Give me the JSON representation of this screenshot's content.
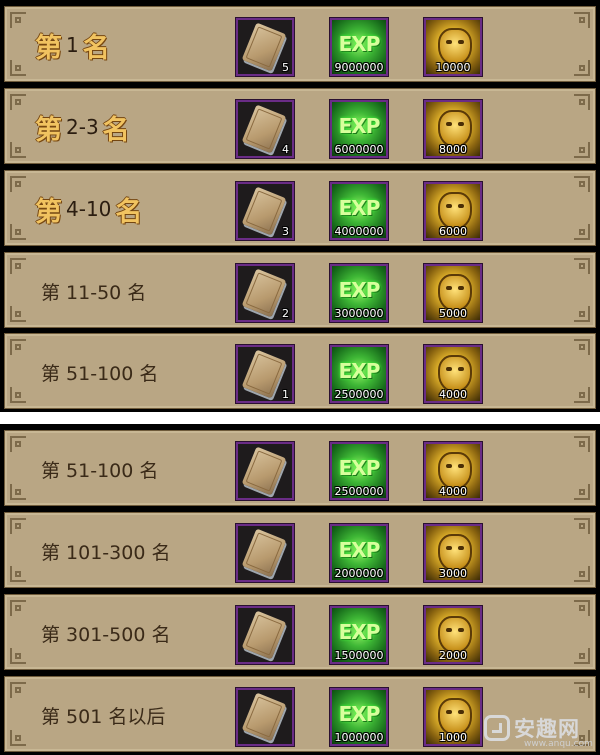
{
  "panels": [
    {
      "rows": [
        {
          "style": "fancy",
          "cj1": "第",
          "num": "1",
          "cj2": "名",
          "book": "5",
          "exp": "9000000",
          "coin": "10000"
        },
        {
          "style": "fancy",
          "cj1": "第",
          "num": "2-3",
          "cj2": "名",
          "book": "4",
          "exp": "6000000",
          "coin": "8000"
        },
        {
          "style": "fancy",
          "cj1": "第",
          "num": "4-10",
          "cj2": "名",
          "book": "3",
          "exp": "4000000",
          "coin": "6000"
        },
        {
          "style": "plain",
          "label": "第 11-50 名",
          "book": "2",
          "exp": "3000000",
          "coin": "5000"
        },
        {
          "style": "plain",
          "label": "第 51-100 名",
          "book": "1",
          "exp": "2500000",
          "coin": "4000"
        }
      ]
    },
    {
      "rows": [
        {
          "style": "plain",
          "label": "第 51-100 名",
          "book": "",
          "exp": "2500000",
          "coin": "4000"
        },
        {
          "style": "plain",
          "label": "第 101-300 名",
          "book": "",
          "exp": "2000000",
          "coin": "3000"
        },
        {
          "style": "plain",
          "label": "第 301-500 名",
          "book": "",
          "exp": "1500000",
          "coin": "2000"
        },
        {
          "style": "plain",
          "label": "第 501 名以后",
          "book": "",
          "exp": "1000000",
          "coin": "1000"
        }
      ]
    }
  ],
  "icons": {
    "book": "skill-book-icon",
    "exp": "exp-icon",
    "coin": "gold-mask-coin-icon"
  },
  "exp_text": "EXP",
  "watermark": {
    "name": "安趣网",
    "url": "www.anqu.com"
  },
  "colors": {
    "row_bg": "#b9a684",
    "border": "#6e5a3a",
    "slot_border": "#6a2c86",
    "gold": "#f1c360"
  }
}
